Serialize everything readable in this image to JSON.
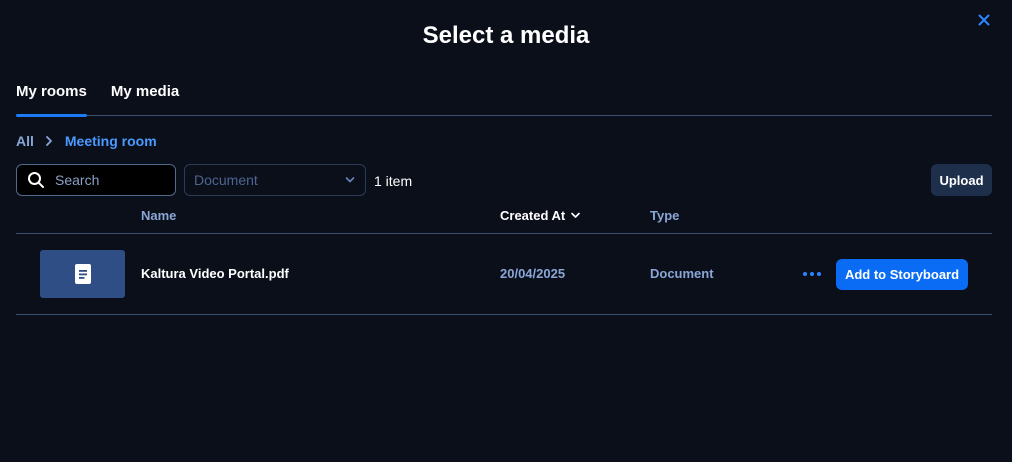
{
  "dialog": {
    "title": "Select a media"
  },
  "tabs": [
    {
      "label": "My rooms",
      "active": true
    },
    {
      "label": "My media",
      "active": false
    }
  ],
  "breadcrumb": {
    "root": "All",
    "current": "Meeting room"
  },
  "toolbar": {
    "search_placeholder": "Search",
    "filter_value": "Document",
    "item_count": "1 item",
    "upload_label": "Upload"
  },
  "table": {
    "columns": {
      "name": "Name",
      "created_at": "Created At",
      "type": "Type"
    },
    "rows": [
      {
        "name": "Kaltura Video Portal.pdf",
        "created_at": "20/04/2025",
        "type": "Document",
        "action_label": "Add to Storyboard"
      }
    ]
  },
  "icons": {
    "close": "close-icon",
    "chevron_right": "chevron-right-icon",
    "search": "search-icon",
    "chevron_down": "chevron-down-icon",
    "sort": "sort-chevron-down-icon",
    "document": "document-icon",
    "more": "more-horizontal-icon"
  },
  "colors": {
    "background": "#0a0f1a",
    "accent": "#0a6cf5",
    "tab_indicator": "#1a7af8",
    "muted_text": "#8aa6d6",
    "thumbnail": "#2f4e86"
  }
}
